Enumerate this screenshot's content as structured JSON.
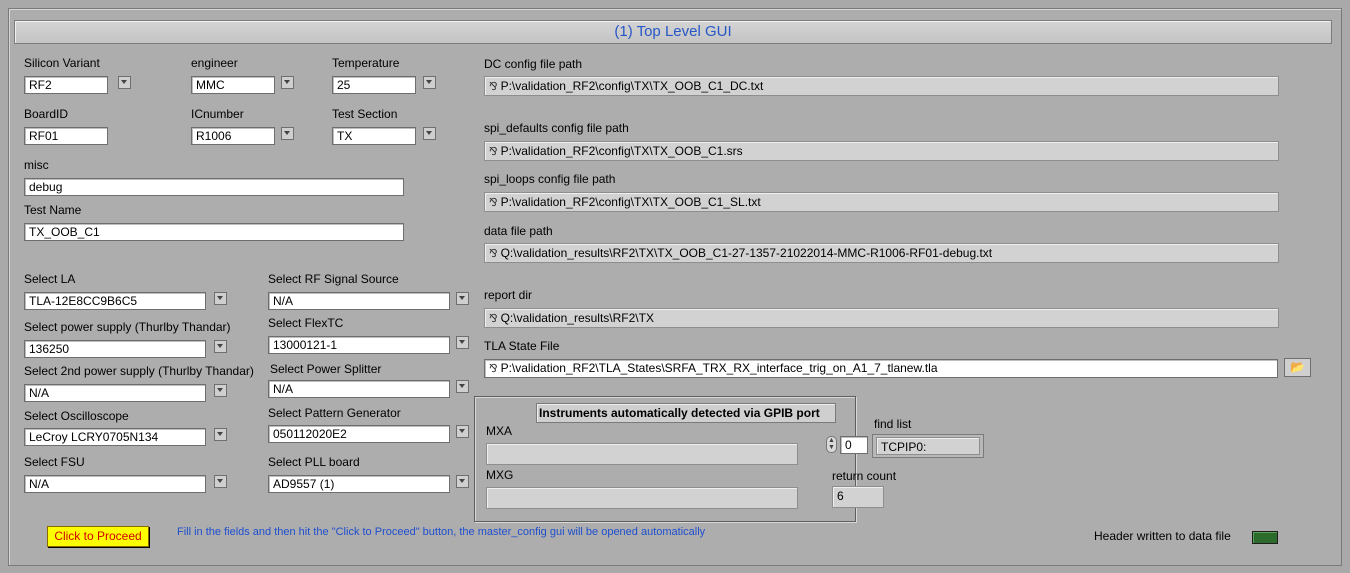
{
  "title": "(1) Top Level GUI",
  "left": {
    "silicon_variant": {
      "label": "Silicon Variant",
      "value": "RF2"
    },
    "engineer": {
      "label": "engineer",
      "value": "MMC"
    },
    "temperature": {
      "label": "Temperature",
      "value": "25"
    },
    "board_id": {
      "label": "BoardID",
      "value": "RF01"
    },
    "ic_number": {
      "label": "ICnumber",
      "value": "R1006"
    },
    "test_section": {
      "label": "Test Section",
      "value": "TX"
    },
    "misc": {
      "label": "misc",
      "value": "debug"
    },
    "test_name": {
      "label": "Test Name",
      "value": "TX_OOB_C1"
    }
  },
  "instruments": {
    "select_la": {
      "label": "Select LA",
      "value": "TLA-12E8CC9B6C5"
    },
    "select_power_supply": {
      "label": "Select power supply (Thurlby Thandar)",
      "value": "136250"
    },
    "select_2nd_power_supply": {
      "label": "Select 2nd power supply (Thurlby Thandar)",
      "value": "N/A"
    },
    "select_oscilloscope": {
      "label": "Select Oscilloscope",
      "value": "LeCroy LCRY0705N134"
    },
    "select_fsu": {
      "label": "Select FSU",
      "value": "N/A"
    },
    "select_rf_signal_source": {
      "label": "Select RF Signal Source",
      "value": "N/A"
    },
    "select_flextc": {
      "label": "Select FlexTC",
      "value": "13000121-1"
    },
    "select_power_splitter": {
      "label": "Select Power Splitter",
      "value": "N/A"
    },
    "select_pattern_generator": {
      "label": "Select Pattern Generator",
      "value": "050112020E2"
    },
    "select_pll_board": {
      "label": "Select PLL board",
      "value": "AD9557 (1)"
    }
  },
  "paths": {
    "dc_config": {
      "label": "DC config file path",
      "value": "P:\\validation_RF2\\config\\TX\\TX_OOB_C1_DC.txt"
    },
    "spi_defaults": {
      "label": "spi_defaults config file path",
      "value": "P:\\validation_RF2\\config\\TX\\TX_OOB_C1.srs"
    },
    "spi_loops": {
      "label": "spi_loops config file path",
      "value": "P:\\validation_RF2\\config\\TX\\TX_OOB_C1_SL.txt"
    },
    "data_file": {
      "label": "data file path",
      "value": "Q:\\validation_results\\RF2\\TX\\TX_OOB_C1-27-1357-21022014-MMC-R1006-RF01-debug.txt"
    },
    "report_dir": {
      "label": "report dir",
      "value": "Q:\\validation_results\\RF2\\TX"
    },
    "tla_state": {
      "label": "TLA State File",
      "value": "P:\\validation_RF2\\TLA_States\\SRFA_TRX_RX_interface_trig_on_A1_7_tlanew.tla"
    }
  },
  "gpib": {
    "title": "Instruments automatically detected via GPIB port",
    "mxa_label": "MXA",
    "mxa_value": "",
    "mxg_label": "MXG",
    "mxg_value": "",
    "find_list_label": "find list",
    "index_value": "0",
    "find_list_value": "TCPIP0:",
    "return_count_label": "return count",
    "return_count_value": "6"
  },
  "footer": {
    "proceed_button": "Click to Proceed",
    "hint": "Fill in the fields and then hit the \"Click to Proceed\" button, the master_config gui will be opened automatically",
    "header_written_label": "Header written to data file",
    "led_color": "#2c6b2c"
  },
  "colors": {
    "title_text": "#2756c7",
    "proceed_bg": "#ffff00",
    "proceed_text": "#d00000",
    "hint_text": "#1f4fd0"
  }
}
